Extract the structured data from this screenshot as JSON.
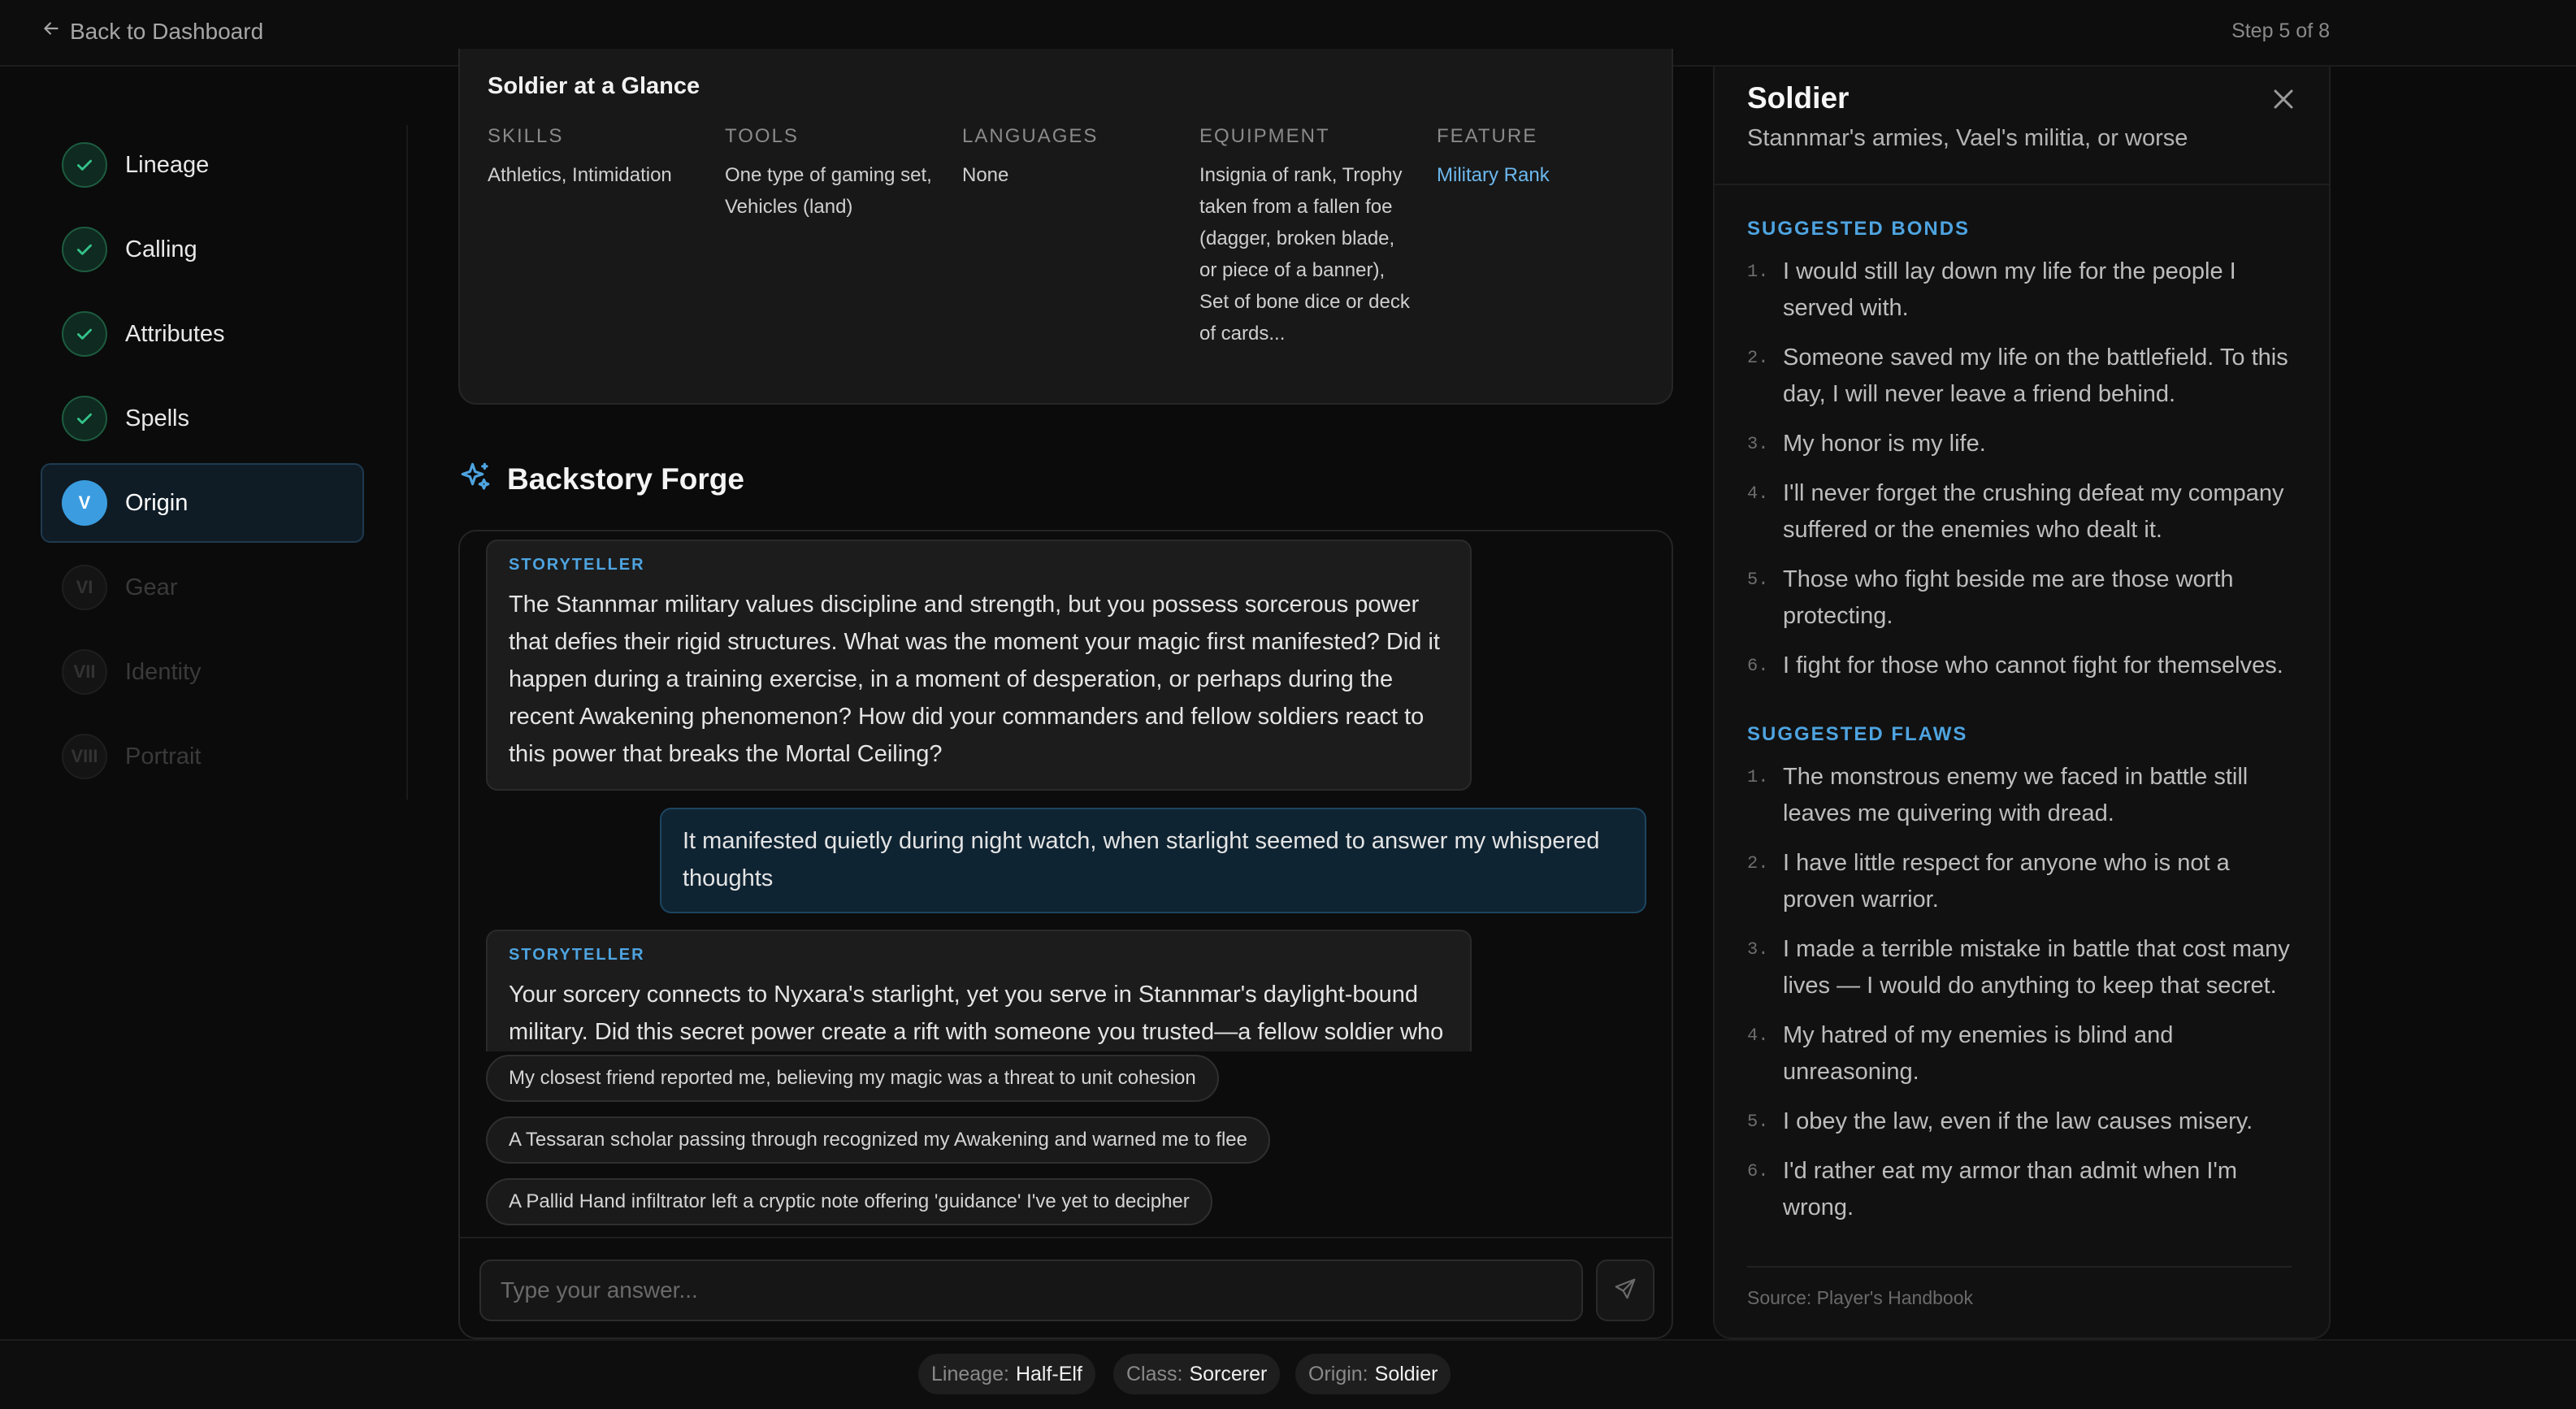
{
  "topbar": {
    "back_label": "Back to Dashboard",
    "step_indicator": "Step 5 of 8"
  },
  "sidebar": {
    "steps": [
      {
        "label": "Lineage",
        "status": "done"
      },
      {
        "label": "Calling",
        "status": "done"
      },
      {
        "label": "Attributes",
        "status": "done"
      },
      {
        "label": "Spells",
        "status": "done"
      },
      {
        "label": "Origin",
        "numeral": "V",
        "status": "current"
      },
      {
        "label": "Gear",
        "numeral": "VI",
        "status": "locked"
      },
      {
        "label": "Identity",
        "numeral": "VII",
        "status": "locked"
      },
      {
        "label": "Portrait",
        "numeral": "VIII",
        "status": "locked"
      }
    ]
  },
  "glance": {
    "title": "Soldier at a Glance",
    "skills_head": "SKILLS",
    "skills": "Athletics, Intimidation",
    "tools_head": "TOOLS",
    "tools": "One type of gaming set, Vehicles (land)",
    "languages_head": "LANGUAGES",
    "languages": "None",
    "equipment_head": "EQUIPMENT",
    "equipment": "Insignia of rank, Trophy taken from a fallen foe (dagger, broken blade, or piece of a banner), Set of bone dice or deck of cards...",
    "feature_head": "FEATURE",
    "feature": "Military Rank"
  },
  "forge": {
    "title": "Backstory Forge",
    "messages": [
      {
        "role": "storyteller",
        "tag": "STORYTELLER",
        "text": "The Stannmar military values discipline and strength, but you possess sorcerous power that defies their rigid structures. What was the moment your magic first manifested? Did it happen during a training exercise, in a moment of desperation, or perhaps during the recent Awakening phenomenon? How did your commanders and fellow soldiers react to this power that breaks the Mortal Ceiling?"
      },
      {
        "role": "user",
        "text": "It manifested quietly during night watch, when starlight seemed to answer my whispered thoughts"
      },
      {
        "role": "storyteller",
        "tag": "STORYTELLER",
        "text": "Your sorcery connects to Nyxara's starlight, yet you serve in Stannmar's daylight-bound military. Did this secret power create a rift with someone you trusted—a fellow soldier who"
      }
    ],
    "suggestions": [
      "My closest friend reported me, believing my magic was a threat to unit cohesion",
      "A Tessaran scholar passing through recognized my Awakening and warned me to flee",
      "A Pallid Hand infiltrator left a cryptic note offering 'guidance' I've yet to decipher"
    ],
    "input_placeholder": "Type your answer...",
    "input_value": ""
  },
  "panel": {
    "title": "Soldier",
    "subtitle": "Stannmar's armies, Vael's militia, or worse",
    "bonds_head": "SUGGESTED BONDS",
    "bonds": [
      {
        "n": "1.",
        "text": "I would still lay down my life for the people I served with."
      },
      {
        "n": "2.",
        "text": "Someone saved my life on the battlefield. To this day, I will never leave a friend behind."
      },
      {
        "n": "3.",
        "text": "My honor is my life."
      },
      {
        "n": "4.",
        "text": "I'll never forget the crushing defeat my company suffered or the enemies who dealt it."
      },
      {
        "n": "5.",
        "text": "Those who fight beside me are those worth protecting."
      },
      {
        "n": "6.",
        "text": "I fight for those who cannot fight for themselves."
      }
    ],
    "flaws_head": "SUGGESTED FLAWS",
    "flaws": [
      {
        "n": "1.",
        "text": "The monstrous enemy we faced in battle still leaves me quivering with dread."
      },
      {
        "n": "2.",
        "text": "I have little respect for anyone who is not a proven warrior."
      },
      {
        "n": "3.",
        "text": "I made a terrible mistake in battle that cost many lives — I would do anything to keep that secret."
      },
      {
        "n": "4.",
        "text": "My hatred of my enemies is blind and unreasoning."
      },
      {
        "n": "5.",
        "text": "I obey the law, even if the law causes misery."
      },
      {
        "n": "6.",
        "text": "I'd rather eat my armor than admit when I'm wrong."
      }
    ],
    "source": "Source: Player's Handbook"
  },
  "summary": {
    "lineage_key": "Lineage:",
    "lineage_val": "Half-Elf",
    "class_key": "Class:",
    "class_val": "Sorcerer",
    "origin_key": "Origin:",
    "origin_val": "Soldier"
  },
  "colors": {
    "accent": "#4ea4e0",
    "done": "#34c28a",
    "background": "#0b0b0b"
  }
}
